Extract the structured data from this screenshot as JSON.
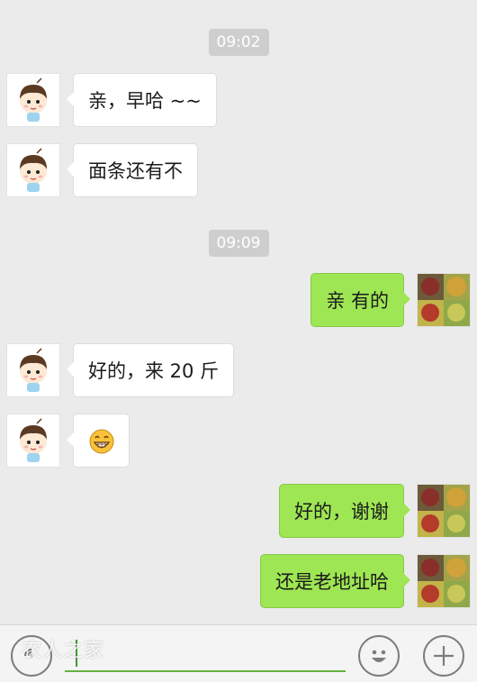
{
  "messages": {
    "t1": "09:02",
    "m1": "亲，早哈 ~~",
    "m2": "面条还有不",
    "t2": "09:09",
    "m3": "亲 有的",
    "m4": "好的，来 20 斤",
    "m5_emoji": "grinning-face",
    "m6": "好的，谢谢",
    "m7": "还是老地址哈"
  },
  "input": {
    "voice_icon": "voice-icon",
    "emoji_icon": "emoji-icon",
    "plus_icon": "plus-icon",
    "watermark": "农人之家"
  },
  "colors": {
    "background": "#ebebeb",
    "incoming_bubble": "#ffffff",
    "outgoing_bubble": "#9ee653",
    "timestamp_bg": "#cecece"
  }
}
